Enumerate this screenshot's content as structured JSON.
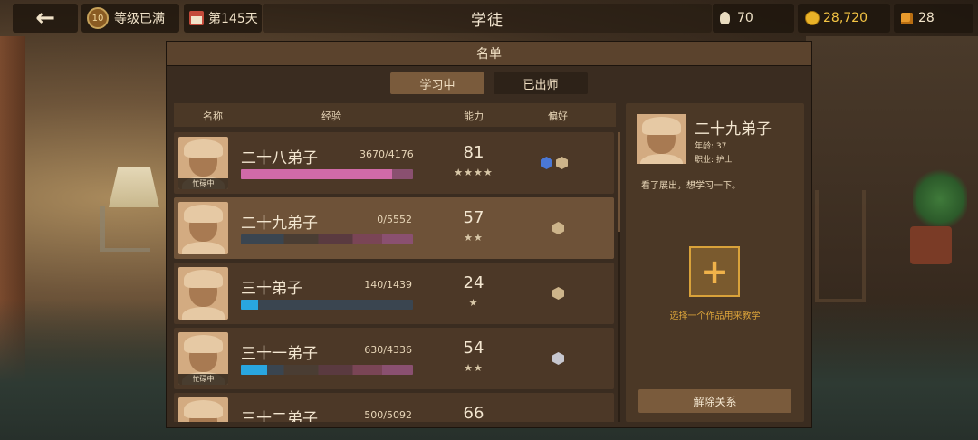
{
  "topbar": {
    "back_icon": "back-arrow-icon",
    "level_number": "10",
    "level_text": "等级已满",
    "day_text": "第145天",
    "title": "学徒",
    "ideas": "70",
    "coins": "28,720",
    "cubes": "28",
    "colors": {
      "coin": "#e9b228",
      "cube": "#e89a2c"
    }
  },
  "panel": {
    "title": "名单",
    "tabs": [
      {
        "label": "学习中",
        "active": true
      },
      {
        "label": "已出师",
        "active": false
      }
    ],
    "columns": {
      "name": "名称",
      "exp": "经验",
      "ability": "能力",
      "pref": "偏好"
    }
  },
  "apprentices": [
    {
      "name": "二十八弟子",
      "exp": "3670/4176",
      "ability": "81",
      "stars": "★★★★",
      "busy": "忙碌中",
      "exp_fraction": 0.88,
      "bar_color": "#d06aa8",
      "prefs": [
        "blue",
        "gold"
      ]
    },
    {
      "name": "二十九弟子",
      "exp": "0/5552",
      "ability": "57",
      "stars": "★★",
      "busy": "",
      "exp_fraction": 0,
      "bar_color": "#d06aa8",
      "prefs": [
        "gold"
      ]
    },
    {
      "name": "三十弟子",
      "exp": "140/1439",
      "ability": "24",
      "stars": "★",
      "busy": "",
      "exp_fraction": 0.1,
      "bar_color": "#29a6e0",
      "prefs": [
        "gold"
      ]
    },
    {
      "name": "三十一弟子",
      "exp": "630/4336",
      "ability": "54",
      "stars": "★★",
      "busy": "忙碌中",
      "exp_fraction": 0.15,
      "bar_color": "#29a6e0",
      "prefs": [
        "silver"
      ]
    },
    {
      "name": "三十二弟子",
      "exp": "500/5092",
      "ability": "66",
      "stars": "",
      "busy": "",
      "exp_fraction": 0.1,
      "bar_color": "#29a6e0",
      "prefs": []
    }
  ],
  "detail": {
    "name": "二十九弟子",
    "age": "年龄: 37",
    "job": "职业: 护士",
    "description": "看了展出，想学习一下。",
    "add_hint": "选择一个作品用来教学",
    "dismiss_label": "解除关系"
  }
}
